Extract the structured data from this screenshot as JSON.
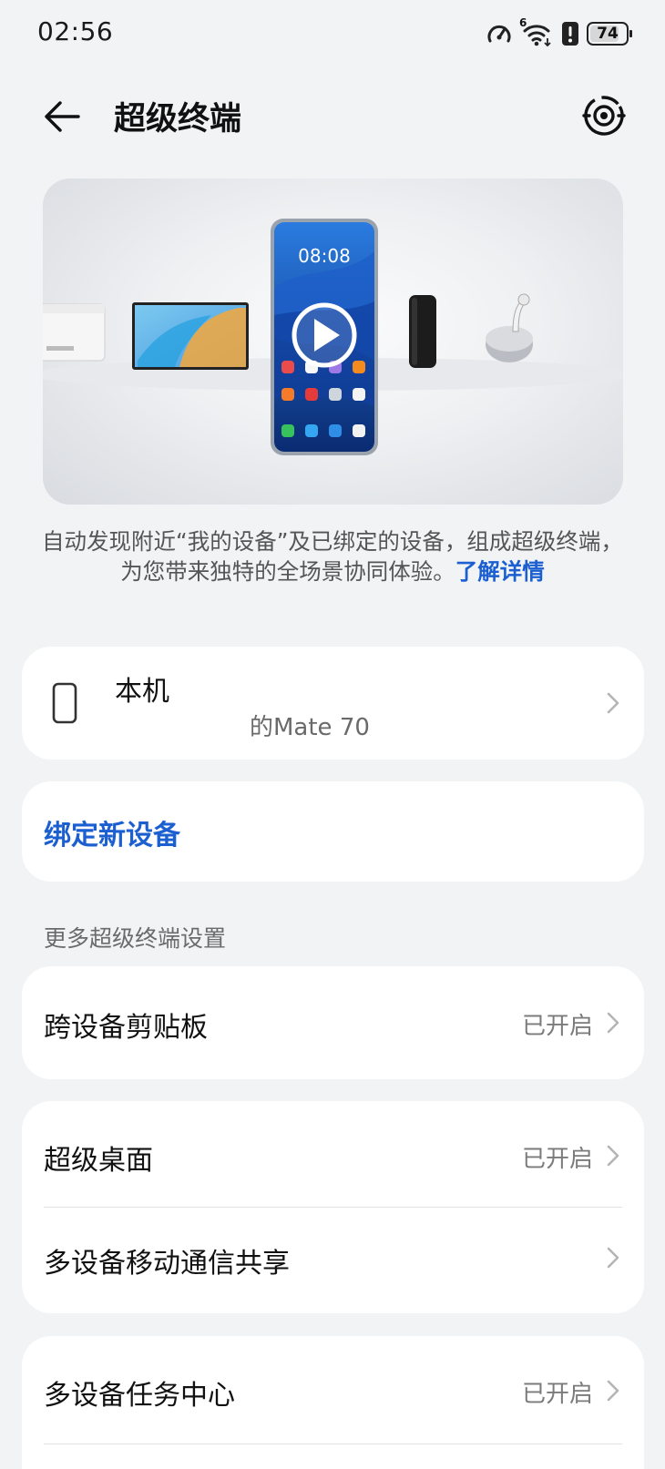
{
  "status_bar": {
    "time": "02:56",
    "network_label": "6",
    "battery_percent": "74",
    "icons": [
      "speedometer-icon",
      "wifi-icon",
      "alert-icon",
      "battery-icon"
    ]
  },
  "header": {
    "title": "超级终端",
    "back_icon": "arrow-left-icon",
    "action_icon": "radar-icon"
  },
  "hero": {
    "phone_time": "08:08",
    "play_icon": "play-icon"
  },
  "description": {
    "text": "自动发现附近“我的设备”及已绑定的设备，组成超级终端，为您带来独特的全场景协同体验。",
    "link": "了解详情"
  },
  "this_device": {
    "title": "本机",
    "subtitle": "的Mate 70",
    "icon": "phone-icon"
  },
  "bind_device": {
    "label": "绑定新设备"
  },
  "more_settings": {
    "title": "更多超级终端设置"
  },
  "settings": {
    "clipboard": {
      "label": "跨设备剪贴板",
      "status": "已开启"
    },
    "super_desktop": {
      "label": "超级桌面",
      "status": "已开启"
    },
    "mobile_share": {
      "label": "多设备移动通信共享"
    },
    "task_center": {
      "label": "多设备任务中心",
      "status": "已开启"
    }
  },
  "colors": {
    "accent": "#1b5fd0",
    "background": "#f1f3f5",
    "card": "#ffffff"
  }
}
